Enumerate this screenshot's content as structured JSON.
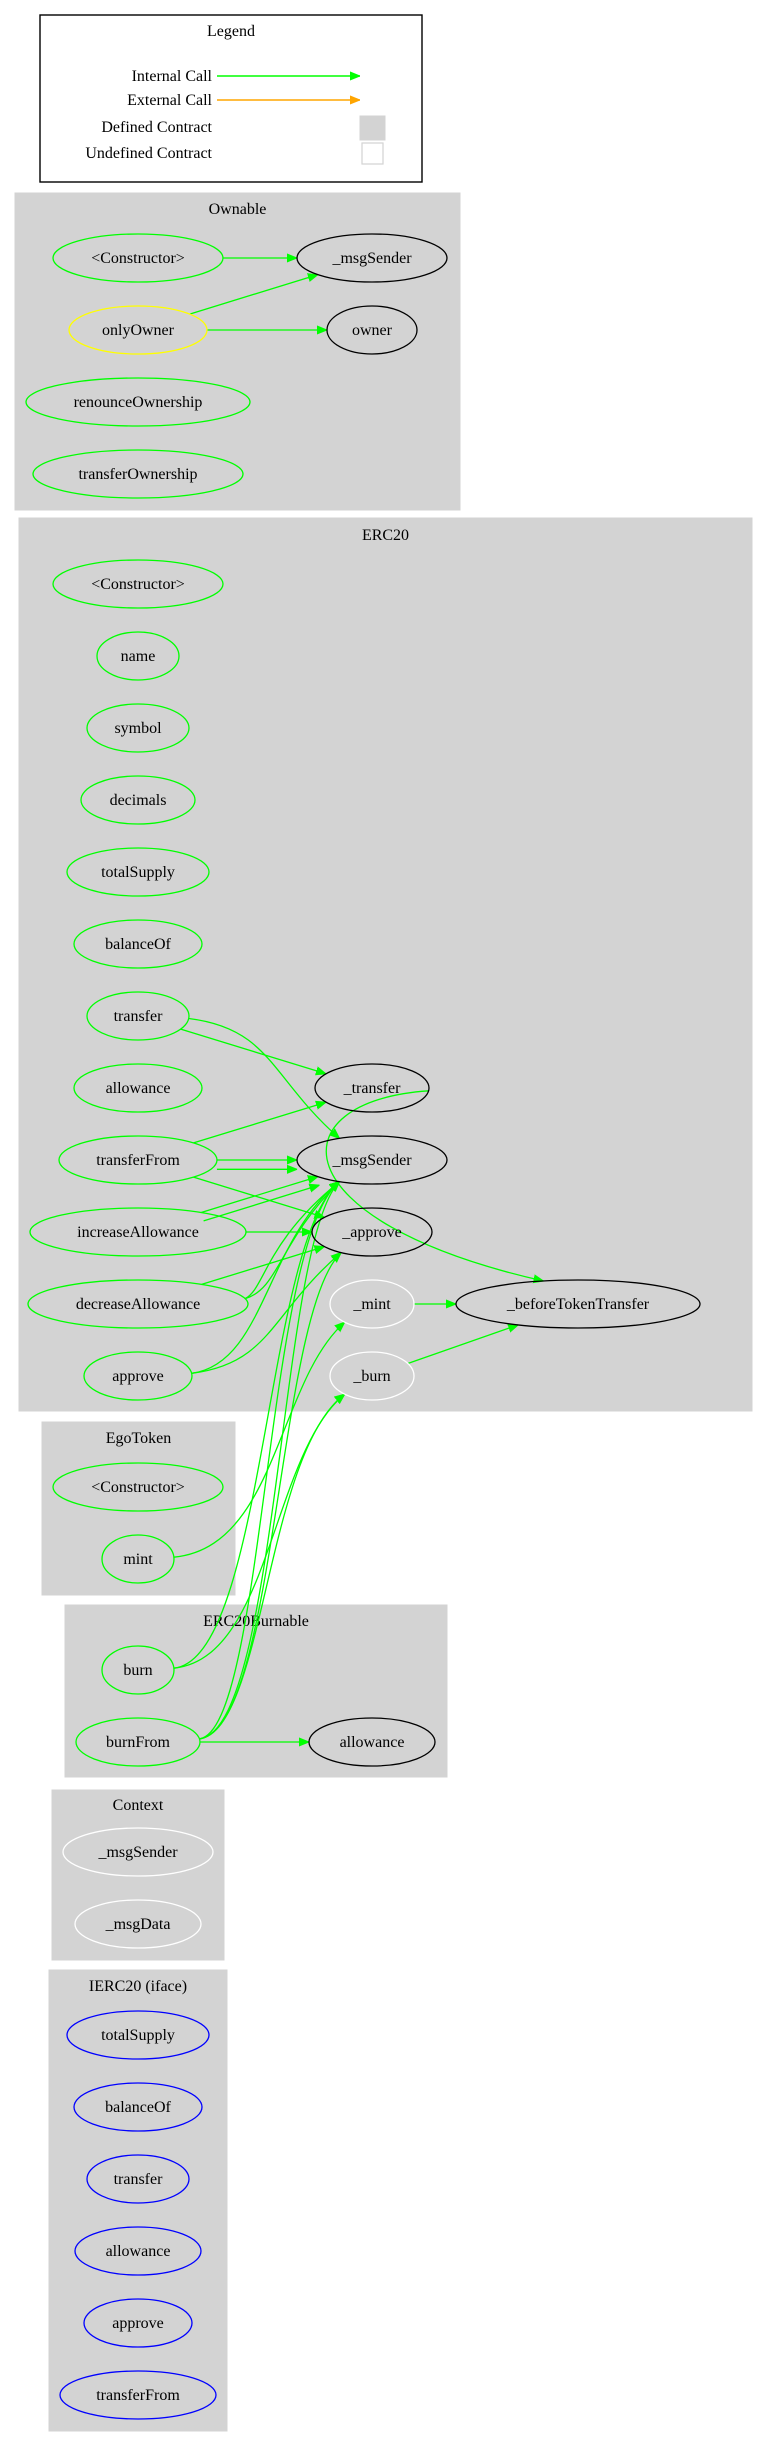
{
  "colors": {
    "internal_call": "#00ff00",
    "external_call": "#ffa500",
    "cluster_fill": "#d3d3d3",
    "public_node": "#00ff00",
    "modifier_node": "#ffff00",
    "internal_node": "#ffffff",
    "defined_node": "#000000",
    "interface_node": "#0000ff"
  },
  "legend": {
    "title": "Legend",
    "items": [
      {
        "label": "Internal Call",
        "kind": "arrow",
        "color": "#00ff00"
      },
      {
        "label": "External Call",
        "kind": "arrow",
        "color": "#ffa500"
      },
      {
        "label": "Defined Contract",
        "kind": "box-filled"
      },
      {
        "label": "Undefined Contract",
        "kind": "box-empty"
      }
    ]
  },
  "clusters": [
    {
      "id": "Ownable",
      "title": "Ownable",
      "nodes": [
        {
          "id": "Ownable.constructor",
          "label": "<Constructor>",
          "stroke": "#00ff00"
        },
        {
          "id": "Ownable._msgSender",
          "label": "_msgSender",
          "stroke": "#000000"
        },
        {
          "id": "Ownable.onlyOwner",
          "label": "onlyOwner",
          "stroke": "#ffff00"
        },
        {
          "id": "Ownable.owner",
          "label": "owner",
          "stroke": "#000000"
        },
        {
          "id": "Ownable.renounceOwnership",
          "label": "renounceOwnership",
          "stroke": "#00ff00"
        },
        {
          "id": "Ownable.transferOwnership",
          "label": "transferOwnership",
          "stroke": "#00ff00"
        }
      ]
    },
    {
      "id": "ERC20",
      "title": "ERC20",
      "nodes": [
        {
          "id": "ERC20.constructor",
          "label": "<Constructor>",
          "stroke": "#00ff00"
        },
        {
          "id": "ERC20.name",
          "label": "name",
          "stroke": "#00ff00"
        },
        {
          "id": "ERC20.symbol",
          "label": "symbol",
          "stroke": "#00ff00"
        },
        {
          "id": "ERC20.decimals",
          "label": "decimals",
          "stroke": "#00ff00"
        },
        {
          "id": "ERC20.totalSupply",
          "label": "totalSupply",
          "stroke": "#00ff00"
        },
        {
          "id": "ERC20.balanceOf",
          "label": "balanceOf",
          "stroke": "#00ff00"
        },
        {
          "id": "ERC20.transfer",
          "label": "transfer",
          "stroke": "#00ff00"
        },
        {
          "id": "ERC20.allowance",
          "label": "allowance",
          "stroke": "#00ff00"
        },
        {
          "id": "ERC20.transferFrom",
          "label": "transferFrom",
          "stroke": "#00ff00"
        },
        {
          "id": "ERC20.increaseAllowance",
          "label": "increaseAllowance",
          "stroke": "#00ff00"
        },
        {
          "id": "ERC20.decreaseAllowance",
          "label": "decreaseAllowance",
          "stroke": "#00ff00"
        },
        {
          "id": "ERC20.approve",
          "label": "approve",
          "stroke": "#00ff00"
        },
        {
          "id": "ERC20._transfer",
          "label": "_transfer",
          "stroke": "#000000"
        },
        {
          "id": "ERC20._msgSender",
          "label": "_msgSender",
          "stroke": "#000000"
        },
        {
          "id": "ERC20._approve",
          "label": "_approve",
          "stroke": "#000000"
        },
        {
          "id": "ERC20._mint",
          "label": "_mint",
          "stroke": "#ffffff"
        },
        {
          "id": "ERC20._burn",
          "label": "_burn",
          "stroke": "#ffffff"
        },
        {
          "id": "ERC20._beforeTokenTransfer",
          "label": "_beforeTokenTransfer",
          "stroke": "#000000"
        }
      ]
    },
    {
      "id": "EgoToken",
      "title": "EgoToken",
      "nodes": [
        {
          "id": "EgoToken.constructor",
          "label": "<Constructor>",
          "stroke": "#00ff00"
        },
        {
          "id": "EgoToken.mint",
          "label": "mint",
          "stroke": "#00ff00"
        }
      ]
    },
    {
      "id": "ERC20Burnable",
      "title": "ERC20Burnable",
      "nodes": [
        {
          "id": "ERC20Burnable.burn",
          "label": "burn",
          "stroke": "#00ff00"
        },
        {
          "id": "ERC20Burnable.burnFrom",
          "label": "burnFrom",
          "stroke": "#00ff00"
        },
        {
          "id": "ERC20Burnable.allowance",
          "label": "allowance",
          "stroke": "#000000"
        }
      ]
    },
    {
      "id": "Context",
      "title": "Context",
      "nodes": [
        {
          "id": "Context._msgSender",
          "label": "_msgSender",
          "stroke": "#ffffff"
        },
        {
          "id": "Context._msgData",
          "label": "_msgData",
          "stroke": "#ffffff"
        }
      ]
    },
    {
      "id": "IERC20",
      "title": "IERC20  (iface)",
      "nodes": [
        {
          "id": "IERC20.totalSupply",
          "label": "totalSupply",
          "stroke": "#0000ff"
        },
        {
          "id": "IERC20.balanceOf",
          "label": "balanceOf",
          "stroke": "#0000ff"
        },
        {
          "id": "IERC20.transfer",
          "label": "transfer",
          "stroke": "#0000ff"
        },
        {
          "id": "IERC20.allowance",
          "label": "allowance",
          "stroke": "#0000ff"
        },
        {
          "id": "IERC20.approve",
          "label": "approve",
          "stroke": "#0000ff"
        },
        {
          "id": "IERC20.transferFrom",
          "label": "transferFrom",
          "stroke": "#0000ff"
        }
      ]
    }
  ],
  "edges": [
    {
      "from": "Ownable.constructor",
      "to": "Ownable._msgSender",
      "type": "internal"
    },
    {
      "from": "Ownable.onlyOwner",
      "to": "Ownable._msgSender",
      "type": "internal"
    },
    {
      "from": "Ownable.onlyOwner",
      "to": "Ownable.owner",
      "type": "internal"
    },
    {
      "from": "ERC20.transfer",
      "to": "ERC20._transfer",
      "type": "internal"
    },
    {
      "from": "ERC20.transfer",
      "to": "ERC20._msgSender",
      "type": "internal"
    },
    {
      "from": "ERC20.transferFrom",
      "to": "ERC20._transfer",
      "type": "internal"
    },
    {
      "from": "ERC20.transferFrom",
      "to": "ERC20._msgSender",
      "type": "internal"
    },
    {
      "from": "ERC20.transferFrom",
      "to": "ERC20._msgSender",
      "type": "internal"
    },
    {
      "from": "ERC20.transferFrom",
      "to": "ERC20._approve",
      "type": "internal"
    },
    {
      "from": "ERC20.increaseAllowance",
      "to": "ERC20._msgSender",
      "type": "internal"
    },
    {
      "from": "ERC20.increaseAllowance",
      "to": "ERC20._msgSender",
      "type": "internal"
    },
    {
      "from": "ERC20.increaseAllowance",
      "to": "ERC20._approve",
      "type": "internal"
    },
    {
      "from": "ERC20.decreaseAllowance",
      "to": "ERC20._msgSender",
      "type": "internal"
    },
    {
      "from": "ERC20.decreaseAllowance",
      "to": "ERC20._msgSender",
      "type": "internal"
    },
    {
      "from": "ERC20.decreaseAllowance",
      "to": "ERC20._approve",
      "type": "internal"
    },
    {
      "from": "ERC20.approve",
      "to": "ERC20._msgSender",
      "type": "internal"
    },
    {
      "from": "ERC20.approve",
      "to": "ERC20._approve",
      "type": "internal"
    },
    {
      "from": "ERC20._transfer",
      "to": "ERC20._beforeTokenTransfer",
      "type": "internal"
    },
    {
      "from": "ERC20._mint",
      "to": "ERC20._beforeTokenTransfer",
      "type": "internal"
    },
    {
      "from": "ERC20._burn",
      "to": "ERC20._beforeTokenTransfer",
      "type": "internal"
    },
    {
      "from": "EgoToken.mint",
      "to": "ERC20._mint",
      "type": "internal"
    },
    {
      "from": "ERC20Burnable.burn",
      "to": "ERC20._msgSender",
      "type": "internal"
    },
    {
      "from": "ERC20Burnable.burn",
      "to": "ERC20._burn",
      "type": "internal"
    },
    {
      "from": "ERC20Burnable.burnFrom",
      "to": "ERC20Burnable.allowance",
      "type": "internal"
    },
    {
      "from": "ERC20Burnable.burnFrom",
      "to": "ERC20._msgSender",
      "type": "internal"
    },
    {
      "from": "ERC20Burnable.burnFrom",
      "to": "ERC20._msgSender",
      "type": "internal"
    },
    {
      "from": "ERC20Burnable.burnFrom",
      "to": "ERC20._approve",
      "type": "internal"
    },
    {
      "from": "ERC20Burnable.burnFrom",
      "to": "ERC20._burn",
      "type": "internal"
    }
  ]
}
